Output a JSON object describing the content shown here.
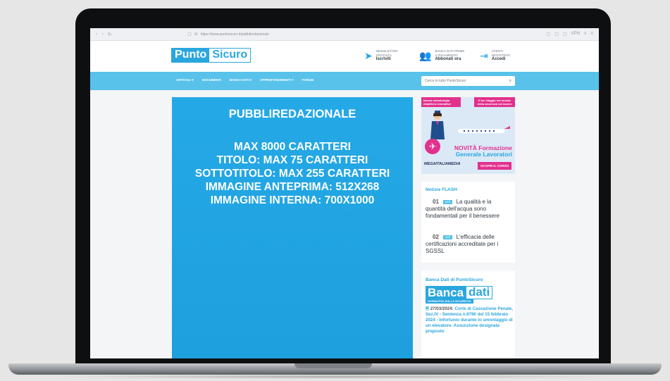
{
  "browser": {
    "url": "https://www.puntosicuro.it/pubbliredazionale",
    "nav_icons": [
      "back-icon",
      "forward-icon",
      "reload-icon"
    ],
    "vpn_label": "VPN"
  },
  "header": {
    "logo_part1": "Punto",
    "logo_part2": "Sicuro",
    "newsletter_line1": "NEWSLETTER",
    "newsletter_line2": "GRATUITA",
    "newsletter_action": "Iscriviti",
    "banca_line1": "BANCA DATI PRIME",
    "banca_line2": "A PAGAMENTO",
    "banca_action": "Abbonati ora",
    "utenti_line1": "UTENTI",
    "utenti_line2": "REGISTRATI",
    "utenti_action": "Accedi"
  },
  "menu": {
    "items": [
      "ARTICOLI ▾",
      "DOCUMENTI",
      "BANCA DATI ▾",
      "APPROFONDIMENTI ▾",
      "FORUM"
    ],
    "search_placeholder": "Cerca in tutto PuntoSicuro"
  },
  "main": {
    "title": "PUBBLIREDAZIONALE",
    "specs": [
      "MAX 8000 CARATTERI",
      "TITOLO: MAX 75 CARATTERI",
      "SOTTOTITOLO: MAX 255 CARATTERI",
      "IMMAGINE ANTEPRIMA: 512X268",
      "IMMAGINE INTERNA: 700X1000"
    ]
  },
  "sidebar": {
    "ad": {
      "tag_left": "Nuova metodologia didattiche interattive",
      "tag_right": "Il tuo viaggio nel mondo della sicurezza sul lavoro",
      "headline1": "NOVITÀ Formazione",
      "headline2": "Generale Lavoratori",
      "brand": "MEGAITALIAMEDIA",
      "cta": "SCOPRI IL CORSO"
    },
    "flash": {
      "title": "Notizie FLASH",
      "items": [
        {
          "num": "01",
          "tag": "APR",
          "text": "La qualità e la quantità dell'acqua sono fondamentali per il benessere"
        },
        {
          "num": "02",
          "tag": "APR",
          "text": "L'efficacia delle certificazioni accreditate per i SGSSL"
        }
      ]
    },
    "banca_dati": {
      "title": "Banca Dati di PuntoSicuro",
      "logo_part1": "Banca",
      "logo_part2": "dati",
      "subtitle": "NORMATIVA SULLA SICUREZZA",
      "date": "27/03/2024:",
      "text": "Corte di Cassazione Penale, Sez.IV - Sentenza n.6790 del 15 febbraio 2024 - Infortunio durante lo smontaggio di un elevatore. Assunzione designata preposto"
    }
  }
}
